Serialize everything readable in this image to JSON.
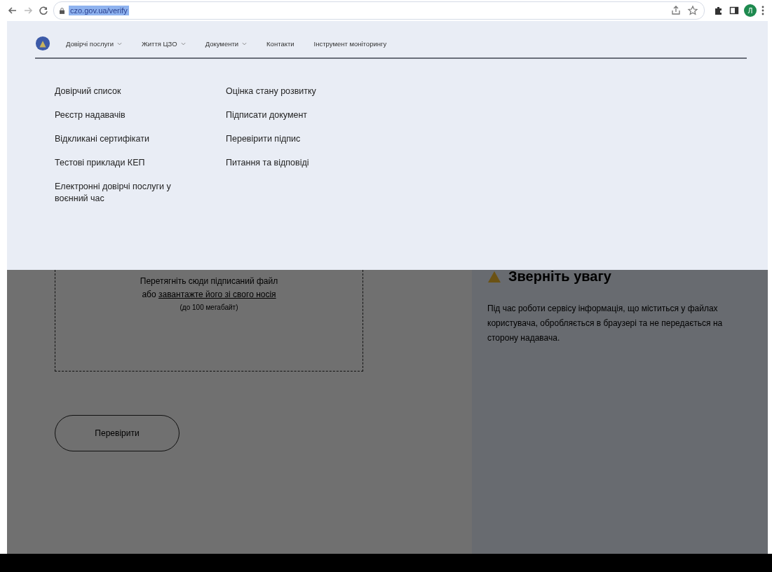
{
  "browser": {
    "url": "czo.gov.ua/verify",
    "avatar": "Л"
  },
  "nav": {
    "items": [
      {
        "label": "Довірчі послуги",
        "dropdown": true
      },
      {
        "label": "Життя ЦЗО",
        "dropdown": true
      },
      {
        "label": "Документи",
        "dropdown": true
      },
      {
        "label": "Контакти",
        "dropdown": false
      },
      {
        "label": "Інструмент моніторингу",
        "dropdown": false
      }
    ]
  },
  "menu": {
    "columns": [
      [
        "Довірчий список",
        "Реєстр надавачів",
        "Відкликані сертифікати",
        "Тестові приклади КЕП",
        "Електронні довірчі послуги у воєнний час"
      ],
      [
        "Оцінка стану розвитку",
        "Підписати документ",
        "Перевірити підпис",
        "Питання та відповіді"
      ]
    ]
  },
  "upload": {
    "drop_text": "Перетягніть сюди підписаний файл",
    "or_text": "або",
    "link": "завантажте його зі свого носія",
    "hint": "(до 100 мегабайт)",
    "button": "Перевірити"
  },
  "notice": {
    "title": "Зверніть увагу",
    "text": "Під час роботи сервісу інформація, що міститься у файлах користувача, обробляється в браузері та не передається на сторону надавача."
  }
}
